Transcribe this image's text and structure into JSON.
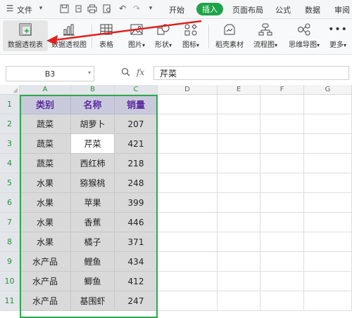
{
  "menubar": {
    "menu_label": "文件",
    "tabs": [
      "开始",
      "插入",
      "页面布局",
      "公式",
      "数据",
      "审阅"
    ],
    "active_tab": "插入"
  },
  "ribbon": {
    "items": [
      {
        "label": "数据透视表",
        "icon": "pivot-table-icon"
      },
      {
        "label": "数据透视图",
        "icon": "pivot-chart-icon"
      },
      {
        "label": "表格",
        "icon": "table-icon"
      },
      {
        "label": "图片",
        "icon": "picture-icon"
      },
      {
        "label": "形状",
        "icon": "shape-icon"
      },
      {
        "label": "图标",
        "icon": "icons-icon"
      },
      {
        "label": "稻壳素材",
        "icon": "material-icon"
      },
      {
        "label": "流程图",
        "icon": "flowchart-icon"
      },
      {
        "label": "思维导图",
        "icon": "mindmap-icon"
      },
      {
        "label": "更多",
        "icon": "more-icon"
      }
    ],
    "dropdown_marker": "▾"
  },
  "formula_bar": {
    "name_box": "B3",
    "fx_label": "fx",
    "value": "芹菜"
  },
  "sheet": {
    "columns": [
      "A",
      "B",
      "C",
      "D",
      "E",
      "F",
      "G"
    ],
    "rows": [
      "1",
      "2",
      "3",
      "4",
      "5",
      "6",
      "7",
      "8",
      "9",
      "10",
      "11"
    ],
    "header": [
      "类别",
      "名称",
      "销量"
    ],
    "data": [
      [
        "蔬菜",
        "胡萝卜",
        "207"
      ],
      [
        "蔬菜",
        "芹菜",
        "421"
      ],
      [
        "蔬菜",
        "西红柿",
        "218"
      ],
      [
        "水果",
        "猕猴桃",
        "248"
      ],
      [
        "水果",
        "苹果",
        "399"
      ],
      [
        "水果",
        "香蕉",
        "446"
      ],
      [
        "水果",
        "橘子",
        "371"
      ],
      [
        "水产品",
        "鲤鱼",
        "434"
      ],
      [
        "水产品",
        "鲫鱼",
        "412"
      ],
      [
        "水产品",
        "基围虾",
        "247"
      ]
    ],
    "active_cell": "B3"
  },
  "colors": {
    "accent_green": "#1fa348",
    "header_fill": "#c9c9dc",
    "header_text": "#5b2c9e",
    "arrow_red": "#e02020"
  }
}
